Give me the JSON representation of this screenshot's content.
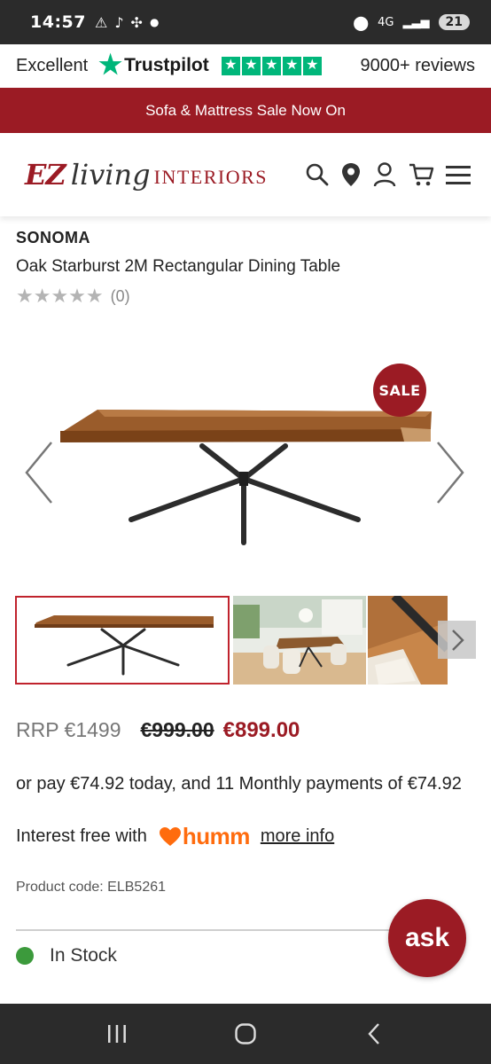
{
  "status_bar": {
    "time": "14:57",
    "network": "4G",
    "battery": "21"
  },
  "trustpilot": {
    "rating_word": "Excellent",
    "brand": "Trustpilot",
    "reviews": "9000+ reviews",
    "stars": 5,
    "color": "#00b67a"
  },
  "banner": {
    "text": "Sofa & Mattress Sale Now On",
    "color": "#9b1b24"
  },
  "header": {
    "logo_ez": "EZ",
    "logo_living": "living",
    "logo_interiors": "INTERIORS",
    "icons": [
      "search-icon",
      "location-icon",
      "account-icon",
      "cart-icon",
      "menu-icon"
    ]
  },
  "product": {
    "brand": "SONOMA",
    "title": "Oak Starburst 2M Rectangular Dining Table",
    "rating_stars": 0,
    "rating_count": "(0)",
    "sale_badge": "SALE",
    "rrp": "RRP €1499",
    "was_price": "€999.00",
    "now_price": "€899.00",
    "pay_text": "or pay €74.92 today, and 11 Monthly payments of €74.92",
    "interest_text": "Interest free with",
    "humm_label": "humm",
    "more_info": "more info",
    "product_code": "Product code: ELB5261",
    "stock": "In Stock"
  },
  "chat": {
    "label": "ask"
  }
}
